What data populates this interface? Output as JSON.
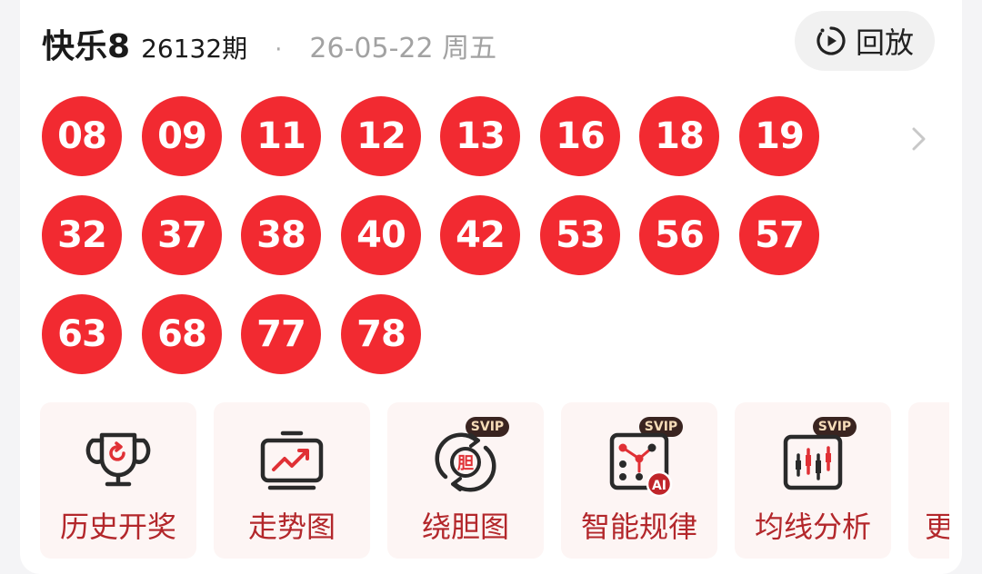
{
  "header": {
    "game_name": "快乐8",
    "issue": "26132期",
    "separator": "·",
    "date": "26-05-22 周五",
    "replay_label": "回放"
  },
  "numbers": [
    "08",
    "09",
    "11",
    "12",
    "13",
    "16",
    "18",
    "19",
    "32",
    "37",
    "38",
    "40",
    "42",
    "53",
    "56",
    "57",
    "63",
    "68",
    "77",
    "78"
  ],
  "tools": [
    {
      "label": "历史开奖",
      "icon": "trophy-icon",
      "badge": ""
    },
    {
      "label": "走势图",
      "icon": "trend-chart-icon",
      "badge": ""
    },
    {
      "label": "绕胆图",
      "icon": "dan-cycle-icon",
      "badge": "SVIP",
      "icon_text": "胆"
    },
    {
      "label": "智能规律",
      "icon": "ai-pattern-icon",
      "badge": "SVIP",
      "icon_text": "AI"
    },
    {
      "label": "均线分析",
      "icon": "average-line-icon",
      "badge": "SVIP"
    },
    {
      "label": "更",
      "icon": "more-icon",
      "badge": ""
    }
  ],
  "colors": {
    "ball": "#f22a31",
    "tile_bg": "#fdf5f4",
    "tile_text": "#b3272b",
    "svip_bg": "#3a2420",
    "svip_text": "#f6dcb8"
  }
}
